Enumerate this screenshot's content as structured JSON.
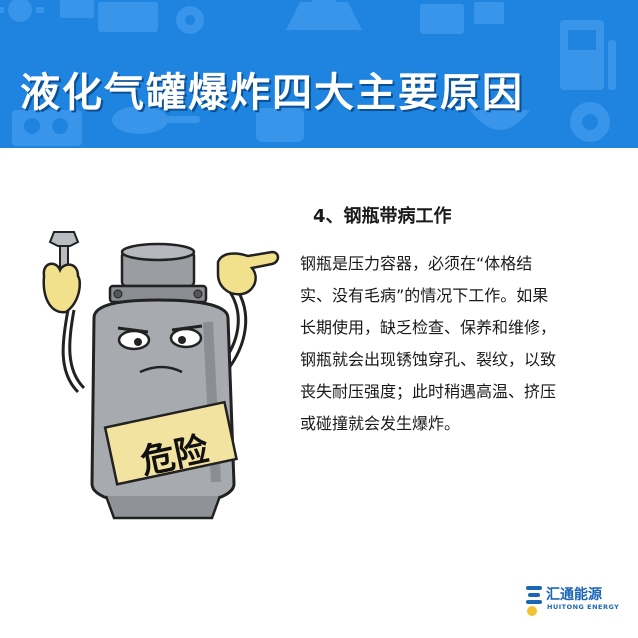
{
  "header": {
    "title": "液化气罐爆炸四大主要原因"
  },
  "illustration": {
    "icon": "gas-cylinder-cartoon",
    "sign_text": "危险"
  },
  "content": {
    "heading": "4、钢瓶带病工作",
    "lines": [
      "钢瓶是压力容器，必须在“体格结",
      "实、没有毛病”的情况下工作。如果",
      "长期使用，缺乏检查、保养和维修，",
      "钢瓶就会出现锈蚀穿孔、裂纹，以致",
      "丧失耐压强度；此时稍遇高温、挤压",
      "或碰撞就会发生爆炸。"
    ]
  },
  "logo": {
    "name_cn": "汇通能源",
    "name_en": "HUITONG ENERGY"
  },
  "colors": {
    "banner": "#1e84e0",
    "title_text": "#ffffff",
    "body_text": "#1a1a1a",
    "logo": "#1b66b7"
  }
}
